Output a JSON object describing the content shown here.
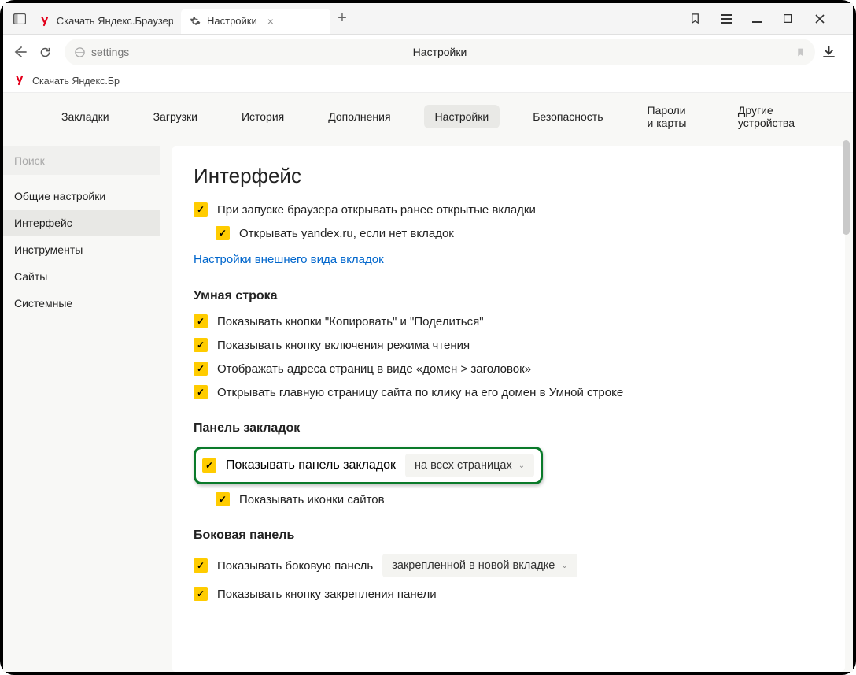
{
  "tabs": {
    "t1": "Скачать Яндекс.Браузер д",
    "t2": "Настройки"
  },
  "addr": {
    "url": "settings",
    "title": "Настройки"
  },
  "bookmarks": {
    "b1": "Скачать Яндекс.Бр"
  },
  "topnav": {
    "n0": "Закладки",
    "n1": "Загрузки",
    "n2": "История",
    "n3": "Дополнения",
    "n4": "Настройки",
    "n5": "Безопасность",
    "n6": "Пароли и карты",
    "n7": "Другие устройства"
  },
  "sidebar": {
    "search_ph": "Поиск",
    "s0": "Общие настройки",
    "s1": "Интерфейс",
    "s2": "Инструменты",
    "s3": "Сайты",
    "s4": "Системные"
  },
  "content": {
    "title": "Интерфейс",
    "o1": "При запуске браузера открывать ранее открытые вкладки",
    "o2": "Открывать yandex.ru, если нет вкладок",
    "link1": "Настройки внешнего вида вкладок",
    "sub2": "Умная строка",
    "o3": "Показывать кнопки \"Копировать\" и \"Поделиться\"",
    "o4": "Показывать кнопку включения режима чтения",
    "o5": "Отображать адреса страниц в виде «домен > заголовок»",
    "o6": "Открывать главную страницу сайта по клику на его домен в Умной строке",
    "sub3": "Панель закладок",
    "o7": "Показывать панель закладок",
    "sel1": "на всех страницах",
    "o8": "Показывать иконки сайтов",
    "sub4": "Боковая панель",
    "o9": "Показывать боковую панель",
    "sel2": "закрепленной в новой вкладке",
    "o10": "Показывать кнопку закрепления панели"
  }
}
